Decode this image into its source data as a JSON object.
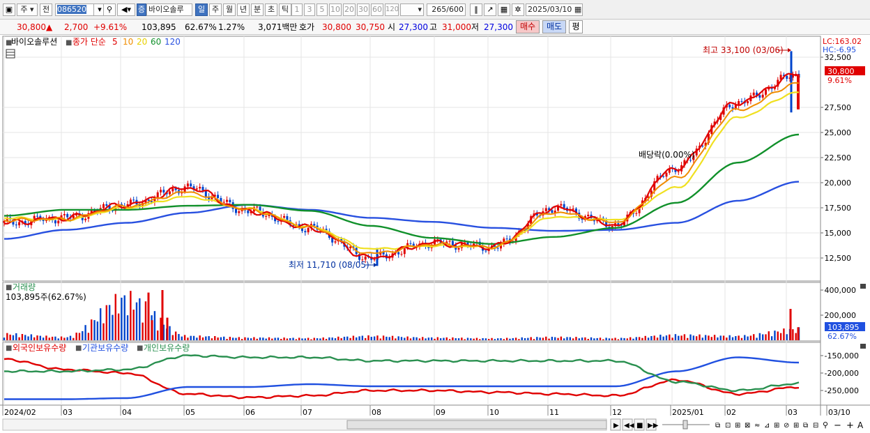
{
  "toolbar": {
    "mode_label": "주",
    "prev_label": "전",
    "code_value": "086520",
    "tag_label": "증",
    "stock_name": "바이오솔루",
    "period_tabs": [
      "일",
      "주",
      "월",
      "년",
      "분",
      "초",
      "틱"
    ],
    "interval_tabs": [
      "1",
      "3",
      "5",
      "10",
      "20",
      "30",
      "60",
      "120"
    ],
    "count_value": "265",
    "count_max": "/600",
    "date_value": "2025/03/10"
  },
  "quote": {
    "price": "30,800",
    "change": "2,700",
    "change_pct": "+9.61%",
    "volume": "103,895",
    "volume_ratio": "62.67%",
    "turnover": "1.27%",
    "amount": "3,071백만",
    "bid_label": "호가",
    "ask_price": "30,800",
    "bid_price": "30,750",
    "open_label": "시",
    "open": "27,300",
    "high_label": "고",
    "high": "31,000",
    "low_label": "저",
    "low": "27,300",
    "buy_label": "매수",
    "sell_label": "매도",
    "avg_label": "평"
  },
  "price_panel": {
    "stock_title": "바이오솔루션",
    "ma_label": "종가 단순",
    "ma_periods": [
      "5",
      "10",
      "20",
      "60",
      "120"
    ],
    "lc_label": "LC:163.02",
    "hc_label": "HC:-6.95",
    "current_label": "30,800",
    "current_pct": "9.61%",
    "max_annotation": "최고 33,100 (03/06)",
    "min_annotation": "최저 11,710 (08/05)",
    "dividend_annotation": "배당락(0.00%)",
    "y_ticks": [
      "32,500",
      "27,500",
      "25,000",
      "22,500",
      "20,000",
      "17,500",
      "15,000",
      "12,500"
    ]
  },
  "volume_panel": {
    "title": "거래량",
    "value_label": "103,895주(62.67%)",
    "y_ticks": [
      "400,000",
      "200,000"
    ],
    "current_label": "103,895",
    "current_pct": "62.67%"
  },
  "holdings_panel": {
    "legend": [
      "외국인보유수량",
      "기관보유수량",
      "개인보유수량"
    ],
    "y_ticks": [
      "-150,000",
      "-200,000",
      "-250,000"
    ]
  },
  "x_axis_labels": [
    "2024/02",
    "03",
    "04",
    "05",
    "06",
    "07",
    "08",
    "09",
    "10",
    "11",
    "12",
    "2025/01",
    "02",
    "03",
    "03/10"
  ],
  "colors": {
    "up": "#e00000",
    "down": "#0044cc",
    "ma5": "#e00000",
    "ma10": "#f08c00",
    "ma20": "#f0e020",
    "ma60": "#10902a",
    "ma120": "#2850e0",
    "foreign": "#e00000",
    "institution": "#2050e0",
    "individual": "#2a9050"
  },
  "chart_data": [
    {
      "type": "candlestick",
      "title": "바이오솔루션",
      "series": [
        {
          "name": "5",
          "x": [
            "2024/02",
            "2024/03",
            "2024/04",
            "2024/05",
            "2024/06",
            "2024/07",
            "2024/08",
            "2024/09",
            "2024/10",
            "2024/11",
            "2024/12",
            "2025/01",
            "2025/02",
            "2025/03/10"
          ],
          "values": [
            16000,
            16500,
            17800,
            19500,
            17200,
            15500,
            12500,
            14000,
            13600,
            17500,
            15800,
            21500,
            28000,
            30800
          ]
        },
        {
          "name": "20",
          "x": [
            "2024/02",
            "2024/03",
            "2024/04",
            "2024/05",
            "2024/06",
            "2024/07",
            "2024/08",
            "2024/09",
            "2024/10",
            "2024/11",
            "2024/12",
            "2025/01",
            "2025/02",
            "2025/03/10"
          ],
          "values": [
            16500,
            16300,
            17500,
            18600,
            17400,
            15600,
            13400,
            13700,
            13600,
            16600,
            16300,
            19500,
            26500,
            29000
          ]
        },
        {
          "name": "60",
          "x": [
            "2024/02",
            "2024/03",
            "2024/04",
            "2024/05",
            "2024/06",
            "2024/07",
            "2024/08",
            "2024/09",
            "2024/10",
            "2024/11",
            "2024/12",
            "2025/01",
            "2025/02",
            "2025/03/10"
          ],
          "values": [
            16700,
            17300,
            17300,
            17700,
            17800,
            17200,
            15700,
            14500,
            13900,
            14600,
            15500,
            18000,
            22000,
            24800
          ]
        },
        {
          "name": "120",
          "x": [
            "2024/02",
            "2024/03",
            "2024/04",
            "2024/05",
            "2024/06",
            "2024/07",
            "2024/08",
            "2024/09",
            "2024/10",
            "2024/11",
            "2024/12",
            "2025/01",
            "2025/02",
            "2025/03/10"
          ],
          "values": [
            14400,
            15300,
            16000,
            17000,
            17800,
            17300,
            16500,
            16100,
            15500,
            15200,
            15300,
            16000,
            18200,
            20100
          ]
        }
      ],
      "max": {
        "date": "03/06",
        "value": 33100
      },
      "min": {
        "date": "08/05",
        "value": 11710
      },
      "last_close": 30800,
      "ylim": [
        10000,
        35000
      ]
    },
    {
      "type": "bar",
      "title": "거래량",
      "series": [
        {
          "name": "거래량",
          "x": [
            "2024/02",
            "2024/03",
            "2024/04",
            "2024/05",
            "2024/06",
            "2024/07",
            "2024/08",
            "2024/09",
            "2024/10",
            "2024/11",
            "2024/12",
            "2025/01",
            "2025/02",
            "2025/03/10"
          ],
          "values": [
            60000,
            30000,
            400000,
            40000,
            25000,
            20000,
            40000,
            25000,
            18000,
            30000,
            20000,
            50000,
            40000,
            103895
          ]
        }
      ],
      "ylim": [
        0,
        450000
      ]
    },
    {
      "type": "line",
      "series": [
        {
          "name": "외국인보유수량",
          "x": [
            "2024/02",
            "2024/03",
            "2024/04",
            "2024/05",
            "2024/06",
            "2024/07",
            "2024/08",
            "2024/09",
            "2024/10",
            "2024/11",
            "2024/12",
            "2025/01",
            "2025/02",
            "2025/03/10"
          ],
          "values": [
            -160000,
            -190000,
            -200000,
            -260000,
            -270000,
            -265000,
            -250000,
            -250000,
            -255000,
            -260000,
            -265000,
            -220000,
            -260000,
            -240000
          ]
        },
        {
          "name": "기관보유수량",
          "x": [
            "2024/02",
            "2024/03",
            "2024/04",
            "2024/05",
            "2024/06",
            "2024/07",
            "2024/08",
            "2024/09",
            "2024/10",
            "2024/11",
            "2024/12",
            "2025/01",
            "2025/02",
            "2025/03/10"
          ],
          "values": [
            -275000,
            -275000,
            -272000,
            -240000,
            -240000,
            -232000,
            -238000,
            -238000,
            -238000,
            -238000,
            -238000,
            -195000,
            -155000,
            -170000
          ]
        },
        {
          "name": "개인보유수량",
          "x": [
            "2024/02",
            "2024/03",
            "2024/04",
            "2024/05",
            "2024/06",
            "2024/07",
            "2024/08",
            "2024/09",
            "2024/10",
            "2024/11",
            "2024/12",
            "2025/01",
            "2025/02",
            "2025/03/10"
          ],
          "values": [
            -195000,
            -195000,
            -190000,
            -150000,
            -155000,
            -155000,
            -165000,
            -165000,
            -165000,
            -165000,
            -165000,
            -225000,
            -250000,
            -230000
          ]
        }
      ],
      "ylim": [
        -290000,
        -130000
      ]
    }
  ]
}
